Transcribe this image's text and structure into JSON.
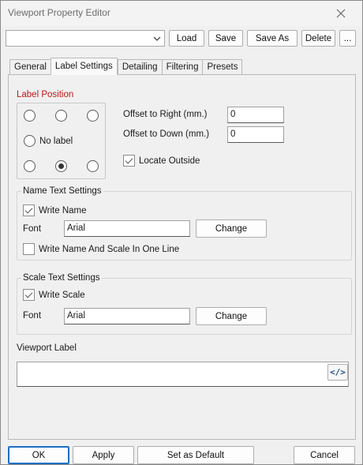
{
  "window": {
    "title": "Viewport Property Editor"
  },
  "toolbar": {
    "preset_value": "",
    "load_label": "Load",
    "save_label": "Save",
    "save_as_label": "Save As",
    "delete_label": "Delete",
    "more_label": "..."
  },
  "tabs": [
    {
      "label": "General"
    },
    {
      "label": "Label Settings"
    },
    {
      "label": "Detailing"
    },
    {
      "label": "Filtering"
    },
    {
      "label": "Presets"
    }
  ],
  "active_tab": "Label Settings",
  "label_position": {
    "title": "Label Position",
    "no_label_text": "No label",
    "selected": "bottom-center"
  },
  "offsets": {
    "right_label": "Offset to Right (mm.)",
    "right_value": "0",
    "down_label": "Offset to Down (mm.)",
    "down_value": "0",
    "locate_outside_label": "Locate Outside",
    "locate_outside_checked": true
  },
  "name_text": {
    "title": "Name Text Settings",
    "write_name_label": "Write Name",
    "write_name_checked": true,
    "font_label": "Font",
    "font_value": "Arial",
    "change_label": "Change",
    "one_line_label": "Write Name And Scale In One Line",
    "one_line_checked": false
  },
  "scale_text": {
    "title": "Scale Text Settings",
    "write_scale_label": "Write Scale",
    "write_scale_checked": true,
    "font_label": "Font",
    "font_value": "Arial",
    "change_label": "Change"
  },
  "viewport_label": {
    "title": "Viewport Label",
    "value": "",
    "code_button_text": "</>"
  },
  "footer": {
    "ok_label": "OK",
    "apply_label": "Apply",
    "set_default_label": "Set as Default",
    "cancel_label": "Cancel"
  },
  "colors": {
    "accent": "#1d6fc4",
    "section_red": "#c0181a",
    "code_icon": "#1d4f8a"
  }
}
